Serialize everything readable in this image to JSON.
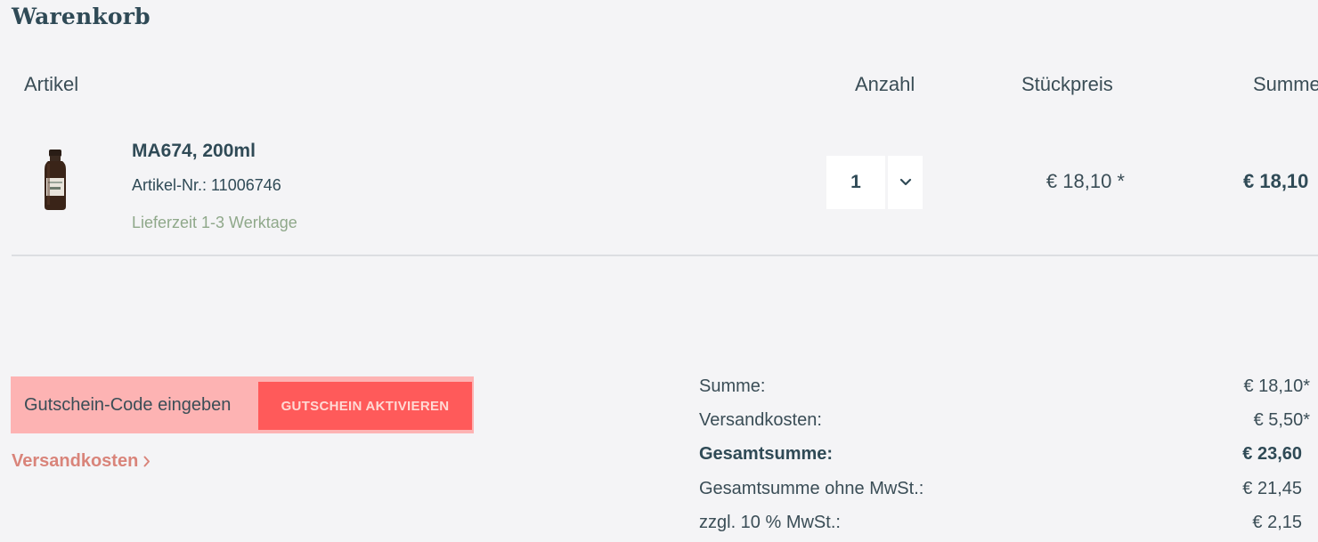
{
  "page": {
    "title": "Warenkorb"
  },
  "table_headers": {
    "article": "Artikel",
    "quantity": "Anzahl",
    "unit_price": "Stückpreis",
    "total": "Summe"
  },
  "item": {
    "name": "MA674, 200ml",
    "sku": "Artikel-Nr.: 11006746",
    "delivery": "Lieferzeit 1-3 Werktage",
    "quantity": "1",
    "unit_price": "€ 18,10 *",
    "total": "€ 18,10"
  },
  "voucher": {
    "placeholder": "Gutschein-Code eingeben",
    "button_label": "GUTSCHEIN AKTIVIEREN"
  },
  "shipping_link": "Versandkosten",
  "summary": {
    "subtotal_label": "Summe:",
    "subtotal_value": "€ 18,10*",
    "shipping_label": "Versandkosten:",
    "shipping_value": "€ 5,50*",
    "grand_total_label": "Gesamtsumme:",
    "grand_total_value": "€ 23,60",
    "net_total_label": "Gesamtsumme ohne MwSt.:",
    "net_total_value": "€ 21,45",
    "vat_label": "zzgl. 10 % MwSt.:",
    "vat_value": "€ 2,15"
  },
  "colors": {
    "title": "#2f4a56",
    "delivery_text": "#8fa88a",
    "voucher_highlight": "#fdb3b3",
    "voucher_button": "#ff5a5a",
    "shipping_link": "#d9847a",
    "background": "#f4f4f6"
  },
  "icons": {
    "quantity_toggle": "chevron-down-icon",
    "shipping_link_arrow": "chevron-right-icon",
    "product_image": "bottle-image"
  }
}
